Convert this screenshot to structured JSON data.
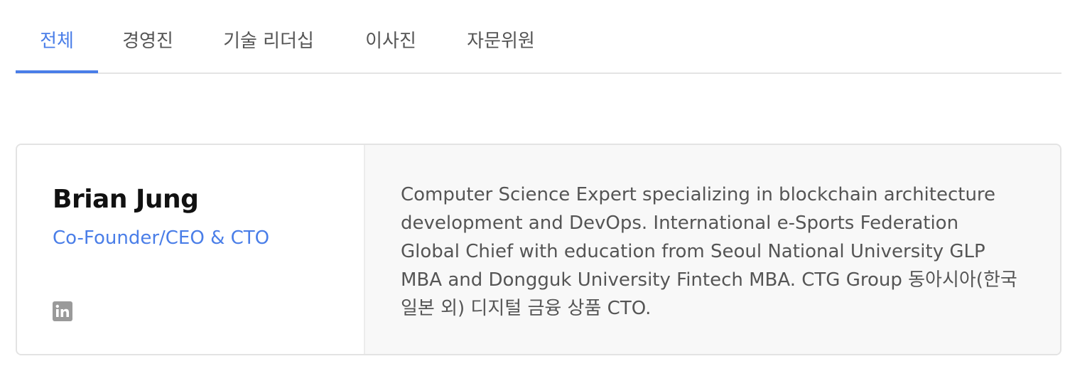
{
  "tabs": [
    {
      "label": "전체",
      "active": true
    },
    {
      "label": "경영진",
      "active": false
    },
    {
      "label": "기술 리더십",
      "active": false
    },
    {
      "label": "이사진",
      "active": false
    },
    {
      "label": "자문위원",
      "active": false
    }
  ],
  "card": {
    "name": "Brian Jung",
    "role": "Co-Founder/CEO & CTO",
    "social_icon": "linkedin-icon",
    "bio": "Computer Science Expert specializing in blockchain architecture\ndevelopment and DevOps. International e-Sports Federation\nGlobal Chief with education from Seoul National University GLP\nMBA and Dongguk University Fintech MBA. CTG Group 동아시아(한국\n일본 외) 디지털 금융 상품 CTO."
  },
  "colors": {
    "accent": "#4a7ee8",
    "text": "#555555",
    "heading": "#111111",
    "panel": "#f8f8f8",
    "border": "#e3e3e3",
    "icon": "#9a9a9a"
  }
}
